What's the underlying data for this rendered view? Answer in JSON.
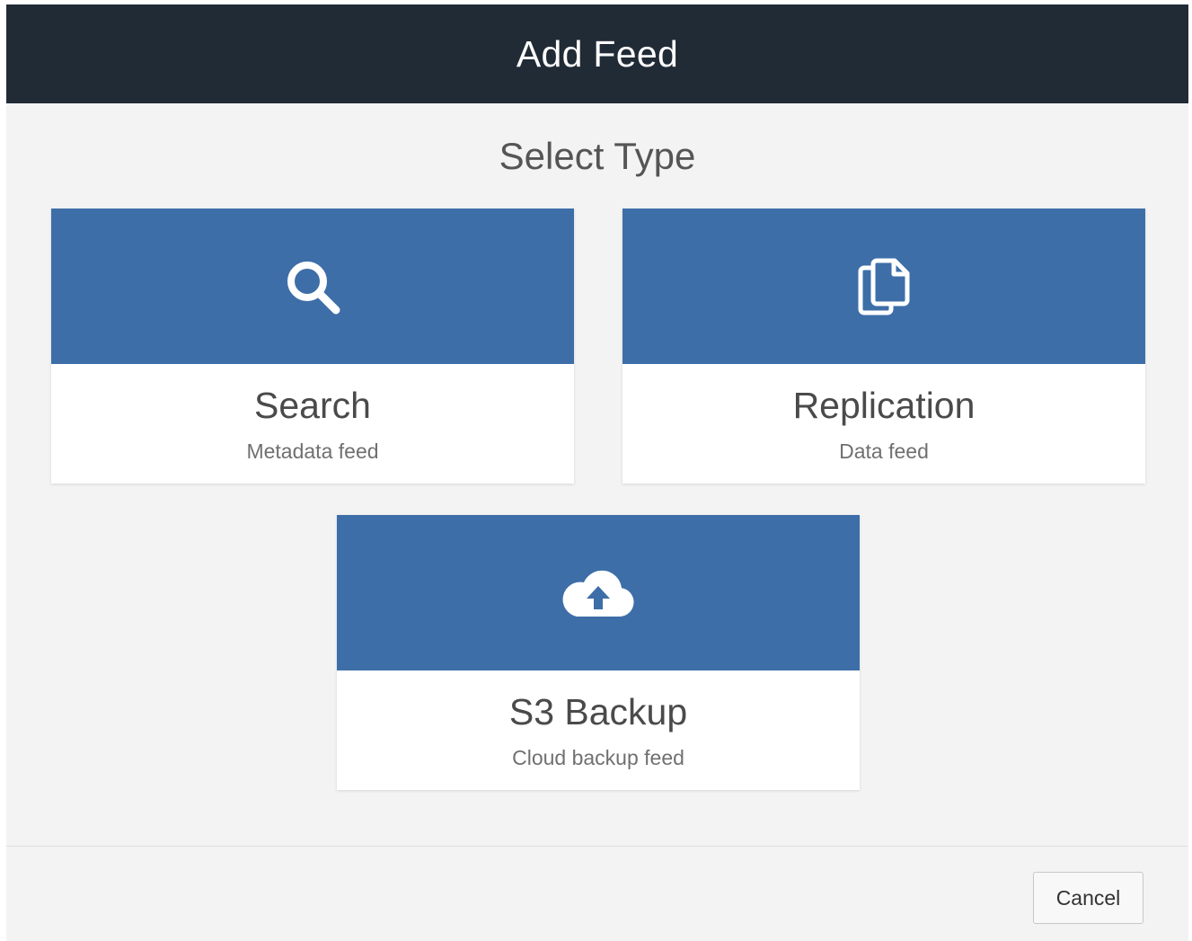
{
  "dialog": {
    "title": "Add Feed",
    "subtitle": "Select Type"
  },
  "cards": [
    {
      "title": "Search",
      "description": "Metadata feed",
      "icon": "search-icon"
    },
    {
      "title": "Replication",
      "description": "Data feed",
      "icon": "copy-files-icon"
    },
    {
      "title": "S3 Backup",
      "description": "Cloud backup feed",
      "icon": "cloud-upload-icon"
    }
  ],
  "footer": {
    "cancel_label": "Cancel"
  },
  "colors": {
    "header_bg": "#212b36",
    "card_accent": "#3d6ea8",
    "body_bg": "#f3f3f3"
  }
}
